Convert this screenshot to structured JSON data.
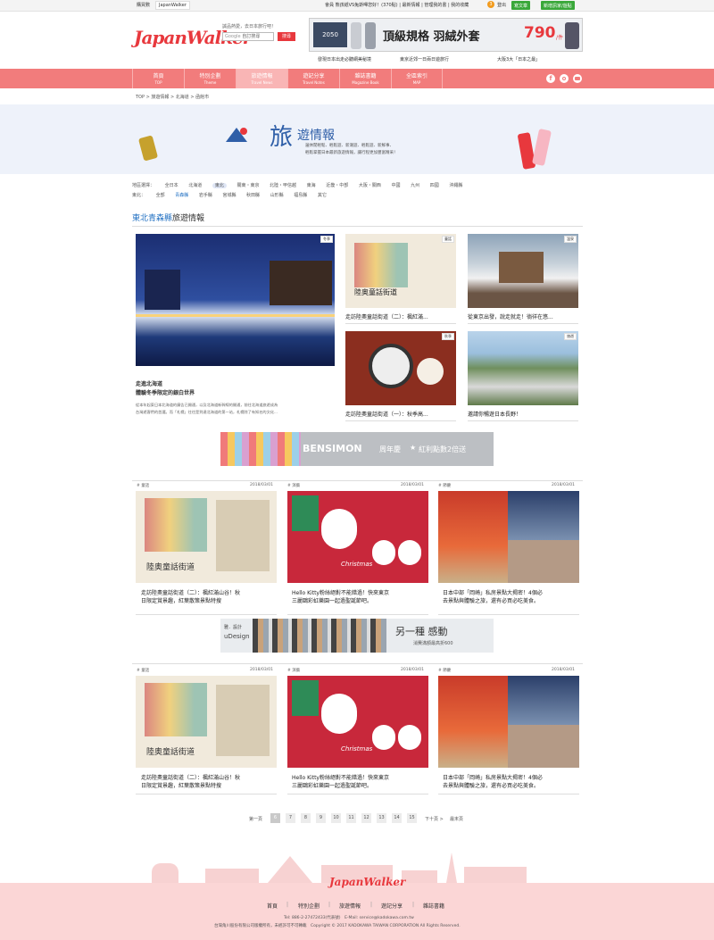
{
  "topbar": {
    "tab1": "購買數",
    "tab2": "JapanWalker",
    "user_text": "會員 熊孩紙VS兔斯嗶您好！(370點) | 最新情報 | 管理我的書 | 我的收藏",
    "badge": "3",
    "logout": "登出",
    "btn_write": "寫文章",
    "btn_new": "新增訊家/遊點"
  },
  "header": {
    "logo": "JapanWalker",
    "tagline": "誠品熱愛，去日本旅行吧！",
    "search_prefix": "Google",
    "search_placeholder": "自訂搜尋",
    "search_btn": "搜尋",
    "banner_text": "頂級規格 羽絨外套",
    "banner_price": "790",
    "banner_unit": "/件",
    "banner_tag": "2050",
    "ticker": [
      "發現日本出走必聽網美秘境",
      "東京近郊一日兩日遊旅行",
      "大阪3大「日本之最」"
    ]
  },
  "nav": [
    {
      "label": "首頁",
      "sub": "TOP"
    },
    {
      "label": "特別企劃",
      "sub": "Theme"
    },
    {
      "label": "旅遊情報",
      "sub": "Travel News"
    },
    {
      "label": "遊記分享",
      "sub": "Travel Notes"
    },
    {
      "label": "雜誌書籍",
      "sub": "Magazine Book"
    },
    {
      "label": "全區索引",
      "sub": "MAP"
    }
  ],
  "breadcrumb": "TOP > 旅遊情報 > 北海道 > 函館市",
  "hero": {
    "big": "旅",
    "title": "遊情報",
    "desc1": "邊休閒輕鬆、輕鬆遊、新潮遊、輕鬆遊、新鮮事、",
    "desc2": "輕鬆掌握日本最新旅遊情報，讓行程更加豐富精采！"
  },
  "filters": {
    "row1_label": "地區選擇：",
    "row1": [
      "全日本",
      "北海道",
      "東北",
      "關東・東京",
      "北陸・甲信越",
      "東海",
      "近畿・中部",
      "大阪・關西",
      "中國",
      "九州",
      "四國",
      "沖繩縣"
    ],
    "row2_label": "東北：",
    "row2": [
      "全部",
      "青森縣",
      "岩手縣",
      "宮城縣",
      "秋田縣",
      "山形縣",
      "福島縣",
      "其它"
    ]
  },
  "section": {
    "blue": "東北青森縣",
    "rest": "旅遊情報"
  },
  "featured": {
    "tag": "冬季",
    "title1": "走進北海道",
    "title2": "體驗冬季限定的銀白世界",
    "desc1": "從本年起東日本北海道的廣告已開通，以及北海道新幹線的開通，前往北海道旅遊成為",
    "desc2": "台灣遊客們的首選。而「札幌」往往是到達北海道的第一站，札幌除了有知名的文化..."
  },
  "small_cards": [
    {
      "tag": "童話",
      "title": "走訪陸奧童話街道（二）：楓紅滿..."
    },
    {
      "tag": "溫泉",
      "title": "從東京出發，說走就走！徜徉在悠..."
    },
    {
      "tag": "秋季",
      "title": "走訪陸奧童話街道（一）：秋季高..."
    },
    {
      "tag": "旅遊",
      "title": "邀請你暢遊日本長野！"
    }
  ],
  "ad1": {
    "brand": "BENSIMON",
    "text": "周年慶",
    "text2": "紅利點數2倍送"
  },
  "ad2": {
    "label1": "雅．設計",
    "label2": "uDesign",
    "text": "另一種 感動",
    "sub": "消費滿額最高折600"
  },
  "article_rows": [
    [
      {
        "tag": "# 童話",
        "date": "2018/03/01",
        "title1": "走訪陸奧童話街道（二）：楓紅滿山谷！秋",
        "title2": "日限定賞景趣，紅葉散策景點特搜"
      },
      {
        "tag": "# 演藝",
        "date": "2018/03/01",
        "title1": "Hello Kitty粉絲絕對不能錯過！快來東京",
        "title2": "三麗鷗彩虹樂園一起過聖誕節吧。"
      },
      {
        "tag": "# 節慶",
        "date": "2018/03/01",
        "title1": "日本中部「岡崎」私房景點大揭密！4個必",
        "title2": "去景點與體驗之旅，還有必買必吃美食。"
      }
    ],
    [
      {
        "tag": "# 童話",
        "date": "2018/03/01",
        "title1": "走訪陸奧童話街道（二）：楓紅滿山谷！秋",
        "title2": "日限定賞景趣，紅葉散策景點特搜"
      },
      {
        "tag": "# 演藝",
        "date": "2018/03/01",
        "title1": "Hello Kitty粉絲絕對不能錯過！快來東京",
        "title2": "三麗鷗彩虹樂園一起過聖誕節吧。"
      },
      {
        "tag": "# 節慶",
        "date": "2018/03/01",
        "title1": "日本中部「岡崎」私房景點大揭密！4個必",
        "title2": "去景點與體驗之旅，還有必買必吃美食。"
      }
    ]
  ],
  "image_text": {
    "map": "陸奥童話街道",
    "xmas": "Christmas"
  },
  "pagination": {
    "first": "第一頁",
    "pages": [
      "6",
      "7",
      "8",
      "9",
      "10",
      "11",
      "12",
      "13",
      "14",
      "15"
    ],
    "next": "下十頁 >",
    "last": "最末頁"
  },
  "footer": {
    "logo": "JapanWalker",
    "links": [
      "首頁",
      "特別企劃",
      "旅遊情報",
      "遊記分享",
      "雜誌書籍"
    ],
    "contact": "Tel: 886-2-27472433(代表號)　E-Mail: service@kadokawa.com.tw",
    "copyright": "台灣角川股份有限公司版權所有，未經許可不可轉載　Copyright © 2017 KADOKAWA TAIWAN CORPORATION All Rights Reserved."
  },
  "colors": {
    "nav": "#f27c7c",
    "accent_blue": "#1f6fc2",
    "footer": "#fbd6d6",
    "green": "#3aa83a"
  }
}
